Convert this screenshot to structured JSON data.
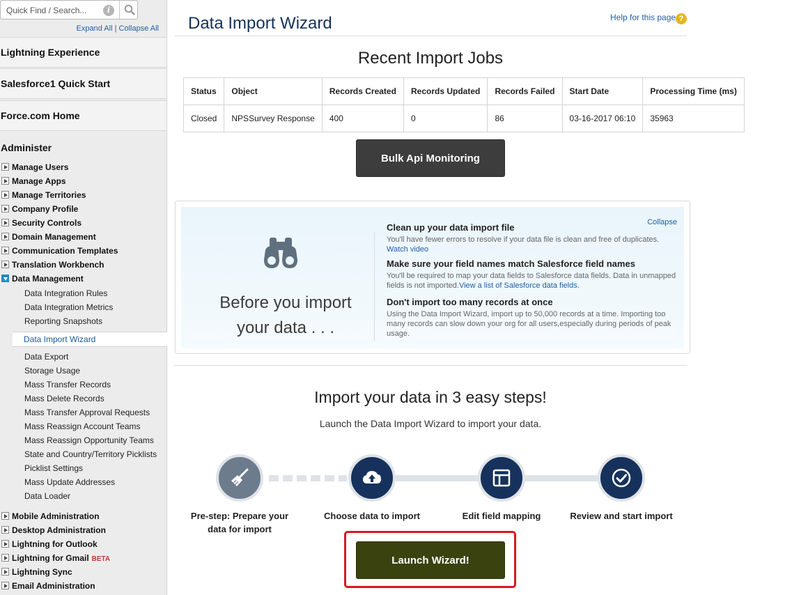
{
  "sidebar": {
    "search_placeholder": "Quick Find / Search...",
    "expand_all": "Expand All",
    "separator": " | ",
    "collapse_all": "Collapse All",
    "sections": [
      "Lightning Experience",
      "Salesforce1 Quick Start",
      "Force.com Home"
    ],
    "administer_title": "Administer",
    "admin_items": [
      "Manage Users",
      "Manage Apps",
      "Manage Territories",
      "Company Profile",
      "Security Controls",
      "Domain Management",
      "Communication Templates",
      "Translation Workbench"
    ],
    "data_management": {
      "label": "Data Management",
      "sub_items_before": [
        "Data Integration Rules",
        "Data Integration Metrics",
        "Reporting Snapshots"
      ],
      "active_item": "Data Import Wizard",
      "sub_items_after": [
        "Data Export",
        "Storage Usage",
        "Mass Transfer Records",
        "Mass Delete Records",
        "Mass Transfer Approval Requests",
        "Mass Reassign Account Teams",
        "Mass Reassign Opportunity Teams",
        "State and Country/Territory Picklists",
        "Picklist Settings",
        "Mass Update Addresses",
        "Data Loader"
      ]
    },
    "bottom_items": [
      "Mobile Administration",
      "Desktop Administration",
      "Lightning for Outlook",
      "Lightning for Gmail",
      "Lightning Sync",
      "Email Administration"
    ],
    "beta_badge": "BETA"
  },
  "header": {
    "title": "Data Import Wizard",
    "help_link": "Help for this page",
    "help_icon": "?"
  },
  "recent_jobs": {
    "title": "Recent Import Jobs",
    "columns": [
      "Status",
      "Object",
      "Records Created",
      "Records Updated",
      "Records Failed",
      "Start Date",
      "Processing Time (ms)"
    ],
    "rows": [
      [
        "Closed",
        "NPSSurvey Response",
        "400",
        "0",
        "86",
        "03-16-2017 06:10",
        "35963"
      ]
    ],
    "monitor_button": "Bulk Api Monitoring"
  },
  "tips": {
    "collapse": "Collapse",
    "before_line1": "Before you import",
    "before_line2": "your data . . .",
    "items": [
      {
        "heading": "Clean up your data import file",
        "text": "You'll have fewer errors to resolve if your data file is clean and free of duplicates.",
        "link": "Watch video"
      },
      {
        "heading": "Make sure your field names match Salesforce field names",
        "text": "You'll be required to map your data fields to Salesforce data fields. Data in unmapped fields is not imported.",
        "link": "View a list of Salesforce data fields."
      },
      {
        "heading": "Don't import too many records at once",
        "text": "Using the Data Import Wizard, import up to 50,000 records at a time. Importing too many records can slow down your org for all users,especially during periods of peak usage."
      }
    ]
  },
  "steps": {
    "title": "Import your data in 3 easy steps!",
    "subtitle": "Launch the Data Import Wizard to import your data.",
    "labels": [
      "Pre-step: Prepare your",
      "data for import",
      "Choose data to import",
      "Edit field mapping",
      "Review and start import"
    ],
    "icons": [
      "broom-icon",
      "cloud-upload-icon",
      "field-mapping-icon",
      "checkmark-icon"
    ],
    "colors": {
      "pre_step": "#6c7c8c",
      "step": "#16325c",
      "launch": "#3a4210",
      "highlight": "#d71920"
    },
    "launch_button": "Launch Wizard!"
  }
}
